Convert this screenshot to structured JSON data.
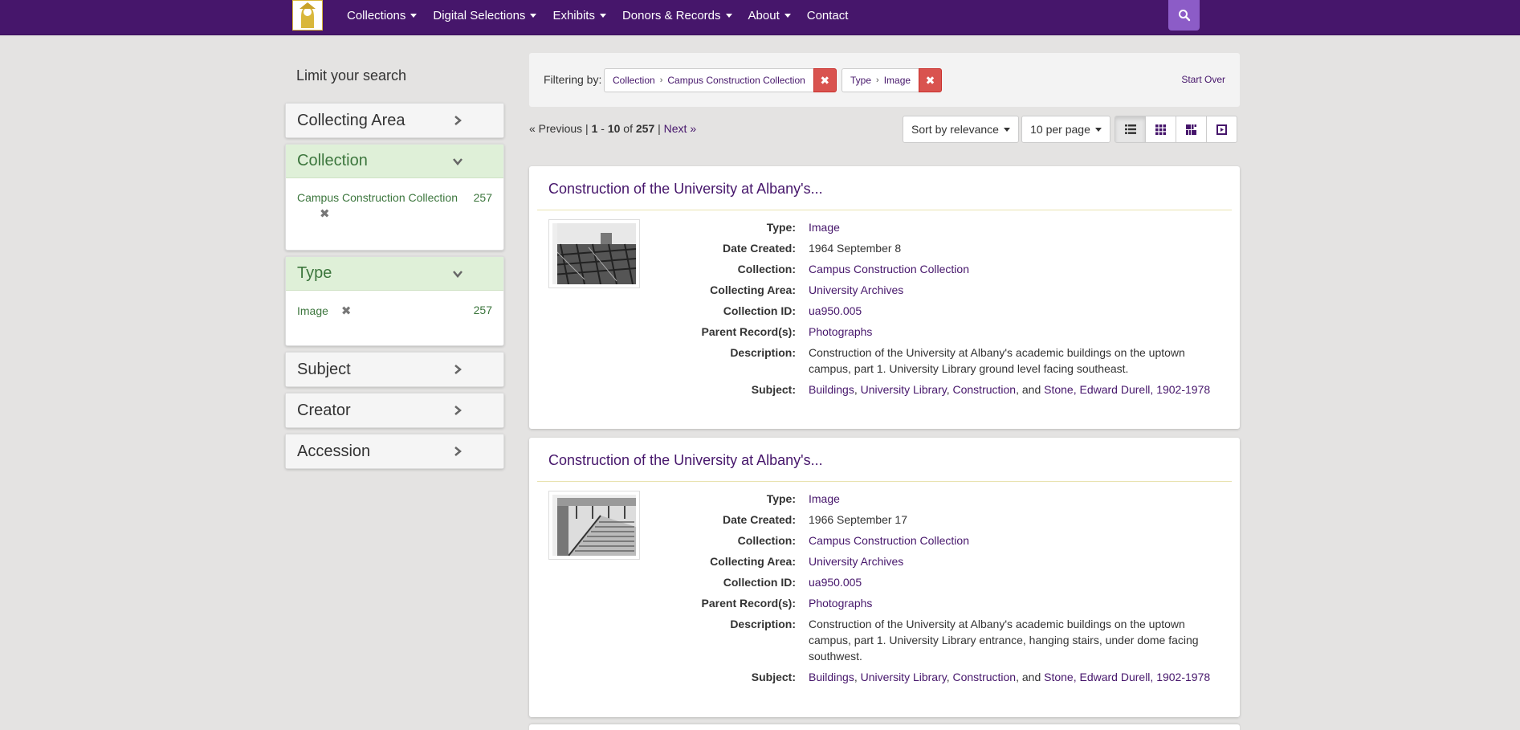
{
  "navbar": {
    "items": [
      {
        "label": "Collections",
        "dropdown": true
      },
      {
        "label": "Digital Selections",
        "dropdown": true
      },
      {
        "label": "Exhibits",
        "dropdown": true
      },
      {
        "label": "Donors & Records",
        "dropdown": true
      },
      {
        "label": "About",
        "dropdown": true
      },
      {
        "label": "Contact",
        "dropdown": false
      }
    ],
    "search_icon": "search-icon",
    "colors": {
      "bar": "#46166b",
      "search": "#8c5cc7",
      "logo_gold": "#d9b73b"
    }
  },
  "sidebar": {
    "title": "Limit your search",
    "facets": [
      {
        "label": "Collecting Area",
        "open": false
      },
      {
        "label": "Collection",
        "open": true,
        "item": "Campus Construction Collection",
        "count": "257"
      },
      {
        "label": "Type",
        "open": true,
        "item": "Image",
        "count": "257"
      },
      {
        "label": "Subject",
        "open": false
      },
      {
        "label": "Creator",
        "open": false
      },
      {
        "label": "Accession",
        "open": false
      }
    ]
  },
  "filters": {
    "label": "Filtering by:",
    "constraints": [
      {
        "field": "Collection",
        "value": "Campus Construction Collection"
      },
      {
        "field": "Type",
        "value": "Image"
      }
    ],
    "start_over": "Start Over"
  },
  "pager": {
    "prev": "« Previous",
    "start": "1",
    "end": "10",
    "of": "of",
    "total": "257",
    "next": "Next »"
  },
  "controls": {
    "sort": "Sort by relevance",
    "per_page": "10 per page",
    "views": [
      "list-view-icon",
      "gallery-view-icon",
      "masonry-view-icon",
      "slideshow-view-icon"
    ]
  },
  "results": [
    {
      "title": "Construction of the University at Albany's...",
      "labels": {
        "type": "Type:",
        "date": "Date Created:",
        "collection": "Collection:",
        "area": "Collecting Area:",
        "id": "Collection ID:",
        "parent": "Parent Record(s):",
        "description": "Description:",
        "subject": "Subject:"
      },
      "type": "Image",
      "date": "1964 September 8",
      "collection": "Campus Construction Collection",
      "area": "University Archives",
      "id": "ua950.005",
      "parent": "Photographs",
      "description": "Construction of the University at Albany's academic buildings on the uptown campus, part 1. University Library ground level facing southeast.",
      "subjects": [
        "Buildings",
        "University Library",
        "Construction",
        "Stone, Edward Durell, 1902-1978"
      ]
    },
    {
      "title": "Construction of the University at Albany's...",
      "labels": {
        "type": "Type:",
        "date": "Date Created:",
        "collection": "Collection:",
        "area": "Collecting Area:",
        "id": "Collection ID:",
        "parent": "Parent Record(s):",
        "description": "Description:",
        "subject": "Subject:"
      },
      "type": "Image",
      "date": "1966 September 17",
      "collection": "Campus Construction Collection",
      "area": "University Archives",
      "id": "ua950.005",
      "parent": "Photographs",
      "description": "Construction of the University at Albany's academic buildings on the uptown campus, part 1. University Library entrance, hanging stairs, under dome facing southwest.",
      "subjects": [
        "Buildings",
        "University Library",
        "Construction",
        "Stone, Edward Durell, 1902-1978"
      ]
    }
  ],
  "subject_joiner": ", and "
}
